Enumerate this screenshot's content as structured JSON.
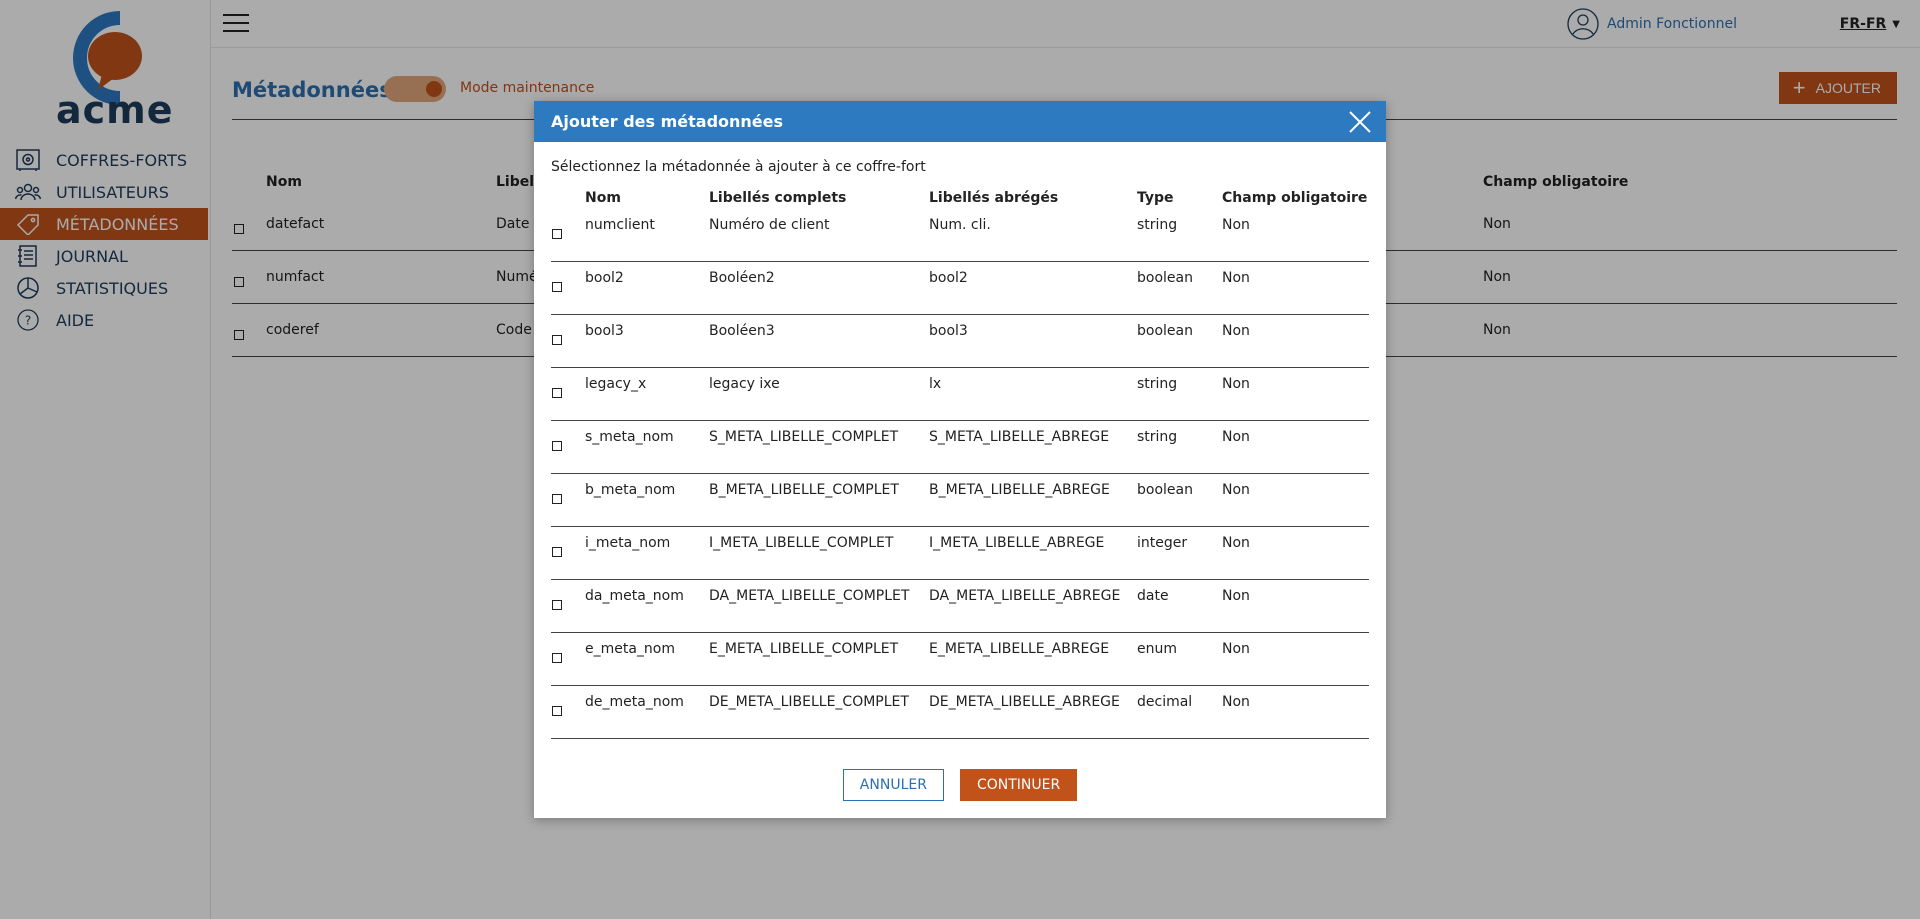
{
  "brand": {
    "logo_text": "acme"
  },
  "nav": {
    "items": [
      {
        "label": "COFFRES-FORTS",
        "icon": "safe-icon",
        "active": false
      },
      {
        "label": "UTILISATEURS",
        "icon": "users-icon",
        "active": false
      },
      {
        "label": "MÉTADONNÉES",
        "icon": "tag-icon",
        "active": true
      },
      {
        "label": "JOURNAL",
        "icon": "journal-icon",
        "active": false
      },
      {
        "label": "STATISTIQUES",
        "icon": "pie-chart-icon",
        "active": false
      },
      {
        "label": "AIDE",
        "icon": "help-icon",
        "active": false
      }
    ]
  },
  "topbar": {
    "user_name": "Admin Fonctionnel",
    "language": "FR-FR"
  },
  "page": {
    "title": "Métadonnées",
    "maintenance_label": "Mode maintenance",
    "maintenance_on": true,
    "add_label": "AJOUTER",
    "table": {
      "headers": {
        "nom": "Nom",
        "libelles": "Libell",
        "required": "Champ obligatoire"
      },
      "rows": [
        {
          "nom": "datefact",
          "libelle": "Date d",
          "required": "Non"
        },
        {
          "nom": "numfact",
          "libelle": "Numé",
          "required": "Non"
        },
        {
          "nom": "coderef",
          "libelle": "Code",
          "required": "Non"
        }
      ]
    }
  },
  "modal": {
    "title": "Ajouter des métadonnées",
    "subtitle": "Sélectionnez la métadonnée à ajouter à ce coffre-fort",
    "headers": {
      "nom": "Nom",
      "full": "Libellés complets",
      "short": "Libellés abrégés",
      "type": "Type",
      "required": "Champ obligatoire"
    },
    "rows": [
      {
        "nom": "numclient",
        "full": "Numéro de client",
        "short": "Num. cli.",
        "type": "string",
        "required": "Non"
      },
      {
        "nom": "bool2",
        "full": "Booléen2",
        "short": "bool2",
        "type": "boolean",
        "required": "Non"
      },
      {
        "nom": "bool3",
        "full": "Booléen3",
        "short": "bool3",
        "type": "boolean",
        "required": "Non"
      },
      {
        "nom": "legacy_x",
        "full": "legacy ixe",
        "short": "lx",
        "type": "string",
        "required": "Non"
      },
      {
        "nom": "s_meta_nom",
        "full": "S_META_LIBELLE_COMPLET",
        "short": "S_META_LIBELLE_ABREGE",
        "type": "string",
        "required": "Non"
      },
      {
        "nom": "b_meta_nom",
        "full": "B_META_LIBELLE_COMPLET",
        "short": "B_META_LIBELLE_ABREGE",
        "type": "boolean",
        "required": "Non"
      },
      {
        "nom": "i_meta_nom",
        "full": "I_META_LIBELLE_COMPLET",
        "short": "I_META_LIBELLE_ABREGE",
        "type": "integer",
        "required": "Non"
      },
      {
        "nom": "da_meta_nom",
        "full": "DA_META_LIBELLE_COMPLET",
        "short": "DA_META_LIBELLE_ABREGE",
        "type": "date",
        "required": "Non"
      },
      {
        "nom": "e_meta_nom",
        "full": "E_META_LIBELLE_COMPLET",
        "short": "E_META_LIBELLE_ABREGE",
        "type": "enum",
        "required": "Non"
      },
      {
        "nom": "de_meta_nom",
        "full": "DE_META_LIBELLE_COMPLET",
        "short": "DE_META_LIBELLE_ABREGE",
        "type": "decimal",
        "required": "Non"
      }
    ],
    "cancel_label": "ANNULER",
    "continue_label": "CONTINUER"
  },
  "colors": {
    "accent": "#c0521a",
    "primary": "#2e7ac0",
    "navy": "#1f3d5c"
  }
}
